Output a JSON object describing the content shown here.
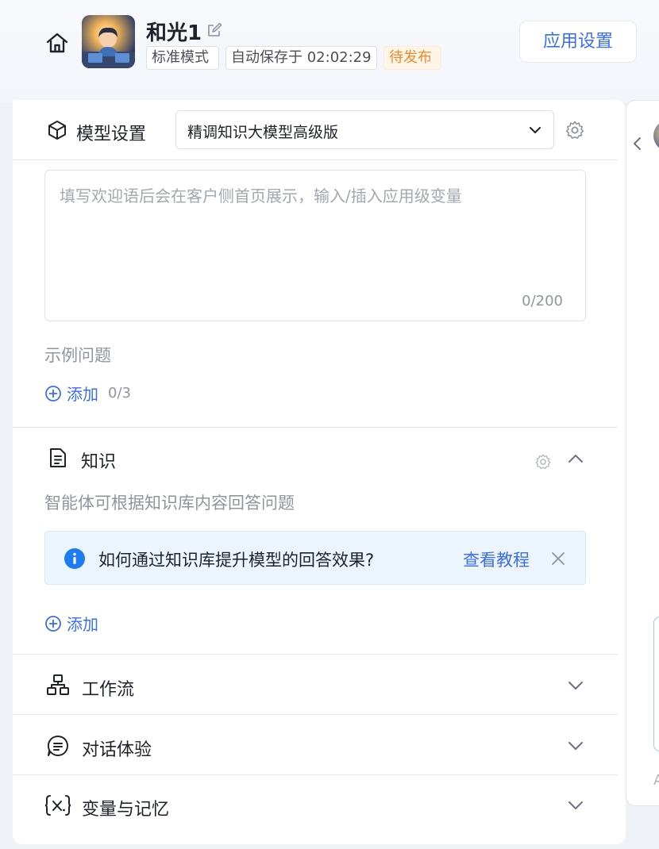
{
  "header": {
    "app_name": "和光1",
    "mode_tag": "标准模式",
    "autosave_tag": "自动保存于 02:02:29",
    "status_tag": "待发布",
    "settings_button": "应用设置"
  },
  "model_settings": {
    "title": "模型设置",
    "selected_model": "精调知识大模型高级版"
  },
  "welcome": {
    "placeholder": "填写欢迎语后会在客户侧首页展示，输入/插入应用级变量",
    "counter": "0/200"
  },
  "example_questions": {
    "title": "示例问题",
    "add_label": "添加",
    "count": "0/3"
  },
  "knowledge": {
    "title": "知识",
    "description": "智能体可根据知识库内容回答问题",
    "banner_text": "如何通过知识库提升模型的回答效果?",
    "banner_link": "查看教程",
    "add_label": "添加"
  },
  "sections": {
    "workflow": "工作流",
    "dialog": "对话体验",
    "variables": "变量与记忆"
  },
  "right_panel": {
    "partial_letter": "A"
  },
  "colors": {
    "accent": "#3a6ef0",
    "pending": "#f08a2c",
    "info_bg": "#ecf5fe"
  }
}
